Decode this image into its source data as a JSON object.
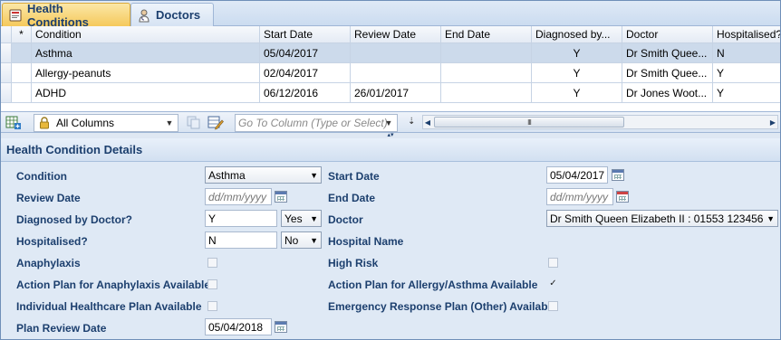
{
  "tabs": [
    {
      "label": "Health Conditions",
      "icon": "health-conditions-icon",
      "active": true
    },
    {
      "label": "Doctors",
      "icon": "doctor-icon",
      "active": false
    }
  ],
  "grid": {
    "columns": [
      "*",
      "Condition",
      "Start Date",
      "Review Date",
      "End Date",
      "Diagnosed by...",
      "Doctor",
      "Hospitalised?"
    ],
    "rows": [
      [
        "",
        "Asthma",
        "05/04/2017",
        "",
        "",
        "Y",
        "Dr Smith Quee...",
        "N"
      ],
      [
        "",
        "Allergy-peanuts",
        "02/04/2017",
        "",
        "",
        "Y",
        "Dr Smith Quee...",
        "Y"
      ],
      [
        "",
        "ADHD",
        "06/12/2016",
        "26/01/2017",
        "",
        "Y",
        "Dr Jones Woot...",
        "Y"
      ]
    ]
  },
  "toolbar": {
    "columns_select": "All Columns",
    "goto_placeholder": "Go To Column (Type or Select)",
    "scroll_thumb": "III"
  },
  "splitter": "▴▾",
  "details": {
    "title": "Health Condition Details",
    "condition": {
      "label": "Condition",
      "value": "Asthma"
    },
    "start_date": {
      "label": "Start Date",
      "value": "05/04/2017"
    },
    "review_date": {
      "label": "Review Date",
      "placeholder": "dd/mm/yyyy"
    },
    "end_date": {
      "label": "End Date",
      "placeholder": "dd/mm/yyyy"
    },
    "diagnosed": {
      "label": "Diagnosed by Doctor?",
      "value": "Y",
      "select": "Yes"
    },
    "doctor": {
      "label": "Doctor",
      "value": "Dr Smith Queen Elizabeth II : 01553 123456"
    },
    "hospitalised": {
      "label": "Hospitalised?",
      "value": "N",
      "select": "No"
    },
    "hospital_name": {
      "label": "Hospital Name"
    },
    "anaphylaxis": {
      "label": "Anaphylaxis",
      "checked": false
    },
    "high_risk": {
      "label": "High Risk",
      "checked": false
    },
    "action_plan_anaphylaxis": {
      "label": "Action Plan for Anaphylaxis Available",
      "checked": false
    },
    "action_plan_allergy": {
      "label": "Action Plan for Allergy/Asthma Available",
      "checked": true,
      "mark": "✓"
    },
    "individual_healthcare": {
      "label": "Individual Healthcare Plan Available",
      "checked": false
    },
    "emergency_response": {
      "label": "Emergency Response Plan (Other) Available",
      "checked": false
    },
    "plan_review_date": {
      "label": "Plan Review Date",
      "value": "05/04/2018"
    }
  },
  "colors": {
    "accent": "#1c3f6e",
    "selected_row": "#ccdaeb",
    "panel": "#dfe9f5",
    "active_tab": "#f5c95b"
  }
}
